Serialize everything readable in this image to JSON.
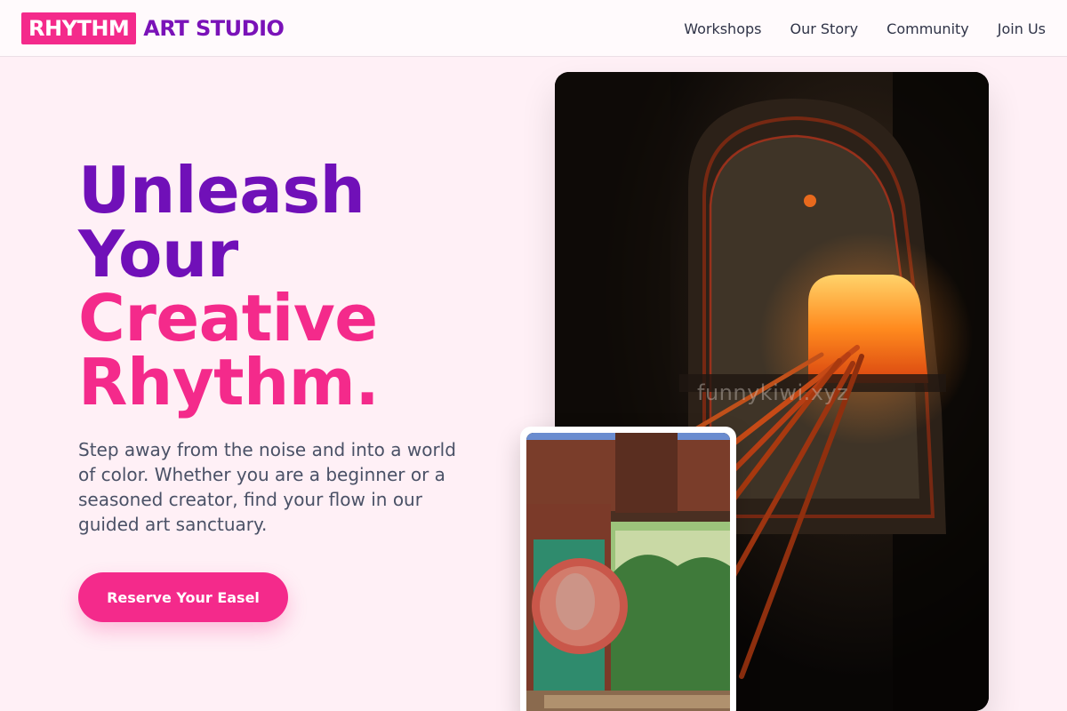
{
  "header": {
    "logo_highlight": "RHYTHM",
    "logo_rest": "ART STUDIO",
    "nav": [
      {
        "label": "Workshops"
      },
      {
        "label": "Our Story"
      },
      {
        "label": "Community"
      },
      {
        "label": "Join Us"
      }
    ]
  },
  "hero": {
    "headline": [
      "Unleash",
      "Your",
      "Creative",
      "Rhythm."
    ],
    "description": "Step away from the noise and into a world of color. Whether you are a beginner or a seasoned creator, find your flow in our guided art sanctuary.",
    "cta_label": "Reserve Your Easel",
    "watermark": "funnykiwi.xyz"
  },
  "colors": {
    "brand_pink": "#f42a8b",
    "brand_purple": "#7010b8",
    "background": "#fff0f6"
  }
}
